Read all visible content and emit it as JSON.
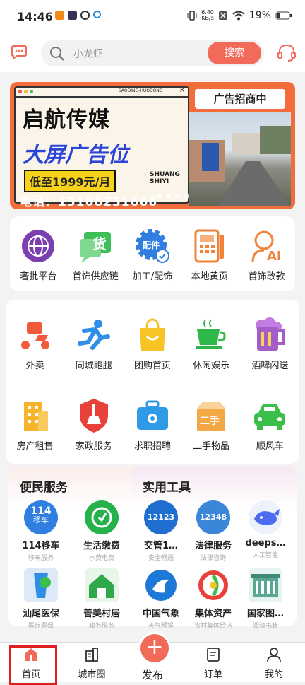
{
  "status": {
    "time": "14:46",
    "net_speed": "6.40",
    "net_unit": "KB/s",
    "battery": "19%"
  },
  "search": {
    "placeholder": "小龙虾",
    "button": "搜索"
  },
  "banner": {
    "line1": "启航传媒",
    "line2": "大屏广告位",
    "price": "低至1999元/月",
    "brand": "SHUANG SHIYI",
    "phone": "电话：13168231666",
    "ad_tag": "广告招商中",
    "window_title": "SAODING-HUODONG"
  },
  "services_row": [
    {
      "label": "奢批平台"
    },
    {
      "label": "首饰供应链"
    },
    {
      "label": "加工/配饰"
    },
    {
      "label": "本地黄页"
    },
    {
      "label": "首饰改款"
    }
  ],
  "categories": [
    {
      "label": "外卖"
    },
    {
      "label": "同城跑腿"
    },
    {
      "label": "团购首页"
    },
    {
      "label": "休闲娱乐"
    },
    {
      "label": "酒啤闪送"
    },
    {
      "label": "房产租售"
    },
    {
      "label": "家政服务"
    },
    {
      "label": "求职招聘"
    },
    {
      "label": "二手物品"
    },
    {
      "label": "顺风车"
    }
  ],
  "convenience": {
    "title": "便民服务",
    "items": [
      {
        "title": "114移车",
        "sub": "移车服务"
      },
      {
        "title": "生活缴费",
        "sub": "水费电费"
      },
      {
        "title": "汕尾医保",
        "sub": "医疗医保"
      },
      {
        "title": "善美村居",
        "sub": "政务服务"
      }
    ]
  },
  "tools": {
    "title": "实用工具",
    "items": [
      {
        "title": "交管1…",
        "sub": "安全畅通"
      },
      {
        "title": "法律服务",
        "sub": "法律咨询"
      },
      {
        "title": "deeps…",
        "sub": "人工智能"
      },
      {
        "title": "中国气象",
        "sub": "天气预报"
      },
      {
        "title": "集体资产",
        "sub": "农村集体经济"
      },
      {
        "title": "国家图…",
        "sub": "阅读书籍"
      }
    ]
  },
  "icon_text": {
    "goods": "货",
    "parts": "配件",
    "second": "二手",
    "plate": "114",
    "plate_sub": "移车",
    "traffic": "12123",
    "law": "12348"
  },
  "tabs": [
    {
      "label": "首页"
    },
    {
      "label": "城市圈"
    },
    {
      "label": "发布"
    },
    {
      "label": "订单"
    },
    {
      "label": "我的"
    }
  ],
  "colors": {
    "accent": "#f26a5a",
    "selected_box": "#e02020"
  }
}
